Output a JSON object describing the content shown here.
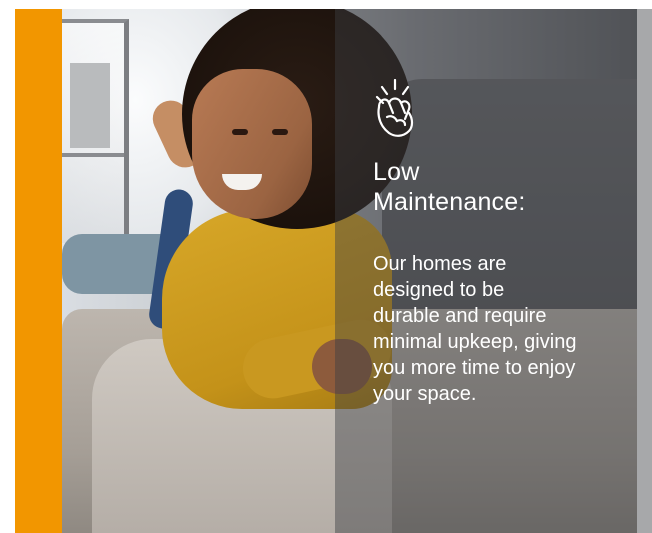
{
  "feature": {
    "icon": "finger-snap-icon",
    "title_line1": "Low",
    "title_line2": "Maintenance:",
    "body_lines": [
      "Our homes are",
      "designed to be",
      "durable and require",
      "minimal upkeep, giving",
      "you more time to enjoy",
      "your space."
    ]
  },
  "colors": {
    "accent": "#f29600",
    "overlay": "#3c3e42",
    "text": "#ffffff"
  },
  "photo": {
    "alt": ""
  }
}
